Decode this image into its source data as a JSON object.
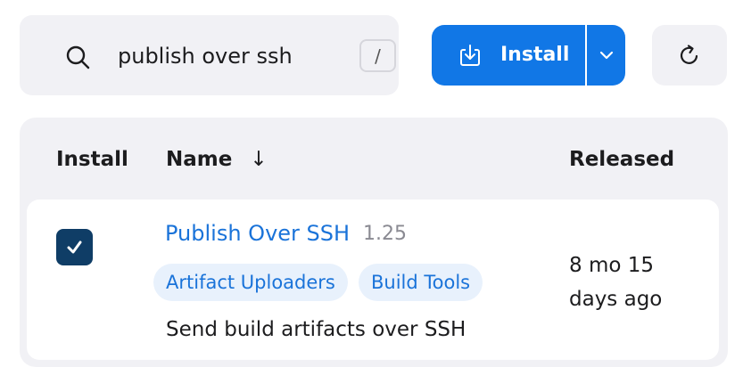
{
  "search": {
    "value": "publish over ssh",
    "shortcut": "/",
    "icon": "search-icon"
  },
  "toolbar": {
    "install_label": "Install",
    "install_icon": "download-icon",
    "caret_icon": "chevron-down-icon",
    "refresh_icon": "refresh-icon",
    "accent_color": "#1177e6"
  },
  "table": {
    "columns": {
      "install": "Install",
      "name": "Name",
      "name_sort": "↓",
      "released": "Released"
    },
    "rows": [
      {
        "checked": true,
        "name": "Publish Over SSH",
        "version": "1.25",
        "tags": [
          "Artifact Uploaders",
          "Build Tools"
        ],
        "description": "Send build artifacts over SSH",
        "released": "8 mo 15 days ago"
      }
    ]
  }
}
